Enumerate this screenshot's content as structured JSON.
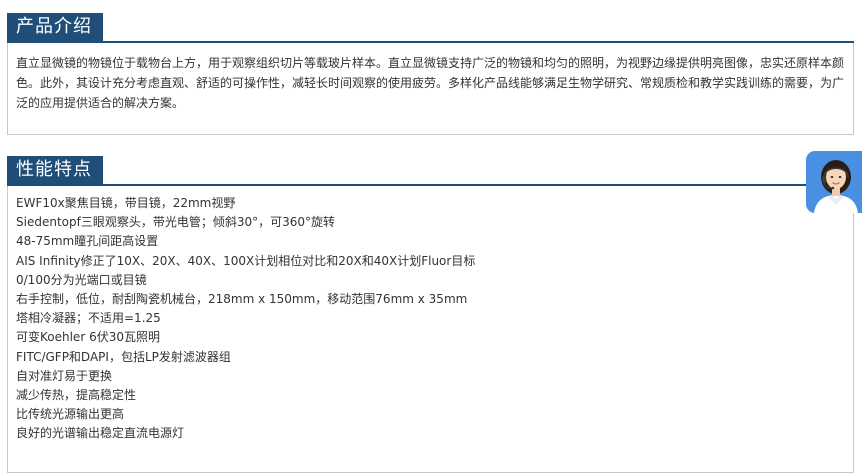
{
  "intro": {
    "title": "产品介绍",
    "text": "直立显微镜的物镜位于载物台上方，用于观察组织切片等载玻片样本。直立显微镜支持广泛的物镜和均匀的照明，为视野边缘提供明亮图像，忠实还原样本颜色。此外，其设计充分考虑直观、舒适的可操作性，减轻长时间观察的使用疲劳。多样化产品线能够满足生物学研究、常规质检和教学实践训练的需要，为广泛的应用提供适合的解决方案。"
  },
  "features": {
    "title": "性能特点",
    "items": [
      "EWF10x聚焦目镜，带目镜，22mm视野",
      "Siedentopf三眼观察头，带光电管；倾斜30°，可360°旋转",
      "48-75mm瞳孔间距高设置",
      "AIS Infinity修正了10X、20X、40X、100X计划相位对比和20X和40X计划Fluor目标",
      "0/100分为光端口或目镜",
      "右手控制，低位，耐刮陶瓷机械台，218mm x 150mm，移动范围76mm x 35mm",
      "塔相冷凝器；不适用=1.25",
      "可变Koehler 6伏30瓦照明",
      "FITC/GFP和DAPI，包括LP发射滤波器组",
      "自对准灯易于更换",
      "减少传热，提高稳定性",
      "比传统光源输出更高",
      "良好的光谱输出稳定直流电源灯"
    ]
  },
  "colors": {
    "header_bg": "#1f4e79",
    "header_text": "#ffffff",
    "body_text": "#333333",
    "border": "#c8c8c8",
    "widget_bg": "#4a90e2"
  },
  "icons": {
    "customer_service": "customer-service-icon"
  }
}
